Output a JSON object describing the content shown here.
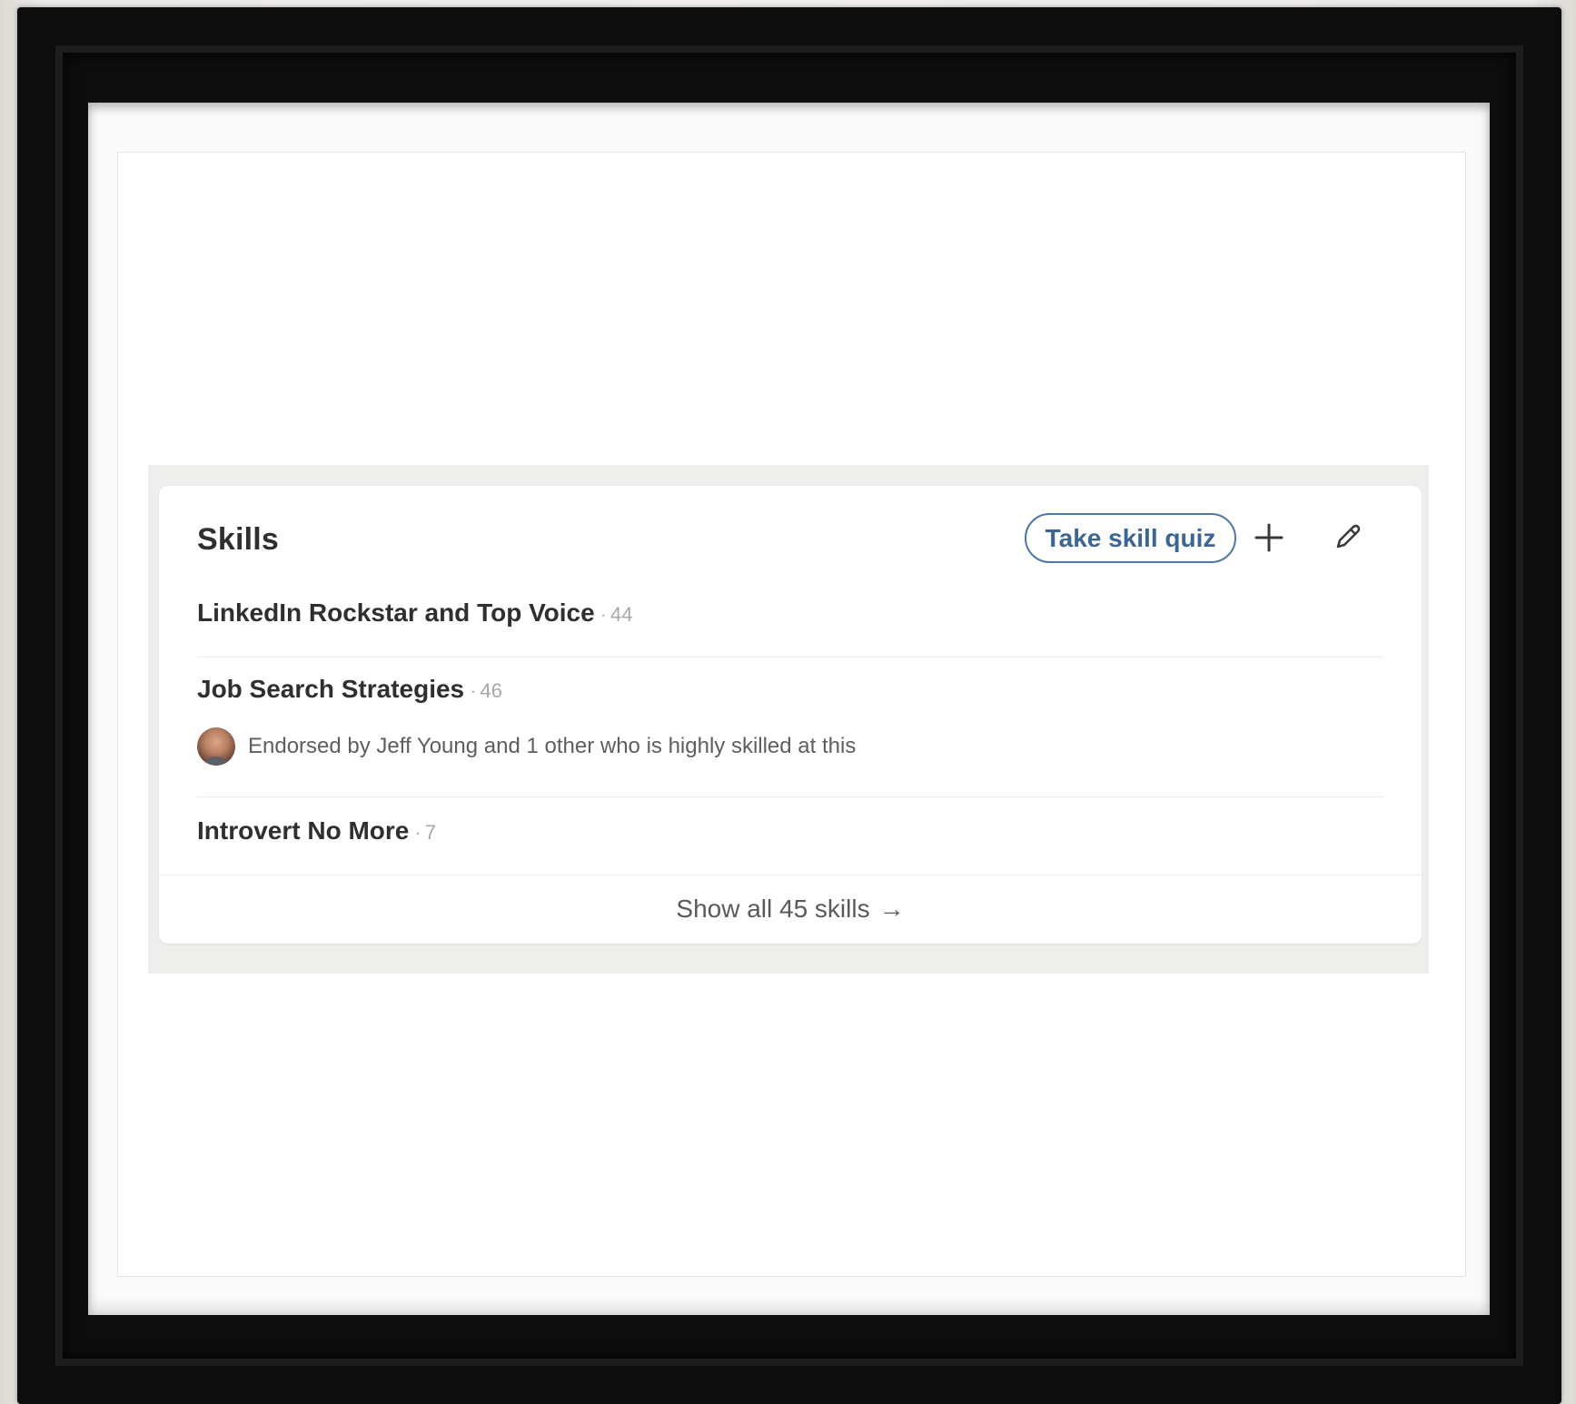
{
  "skills_section": {
    "title": "Skills",
    "take_quiz_label": "Take skill quiz",
    "add_icon": "plus-icon",
    "edit_icon": "pencil-icon",
    "items": [
      {
        "name": "LinkedIn Rockstar and Top Voice",
        "separator": "·",
        "endorsements": "44"
      },
      {
        "name": "Job Search Strategies",
        "separator": "·",
        "endorsements": "46",
        "endorsement_note": "Endorsed by Jeff Young and 1 other who is highly skilled at this"
      },
      {
        "name": "Introvert No More",
        "separator": "·",
        "endorsements": "7"
      }
    ],
    "show_all_label": "Show all 45 skills",
    "show_all_arrow": "→"
  },
  "colors": {
    "frame": "#0d0d0d",
    "accent": "#3c6594",
    "text": "#2f2f2f",
    "muted": "#a8a8a8"
  }
}
